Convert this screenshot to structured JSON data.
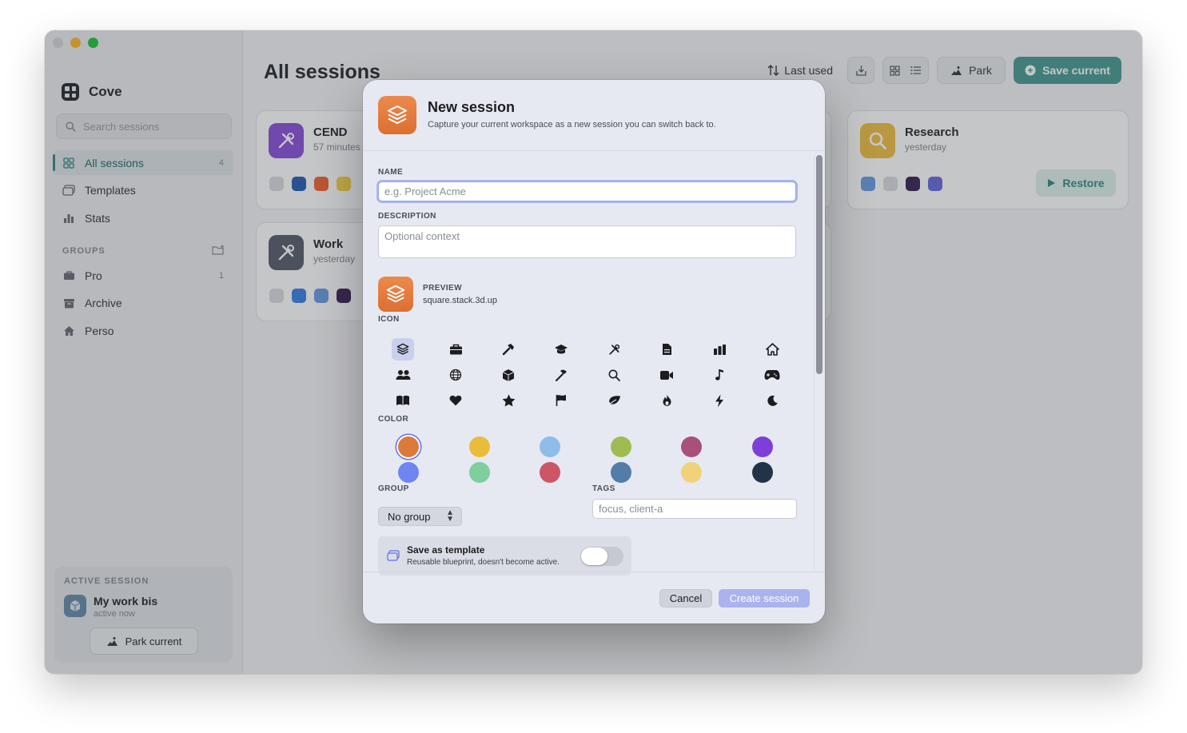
{
  "app": {
    "name": "Cove"
  },
  "sidebar": {
    "search_placeholder": "Search sessions",
    "nav": [
      {
        "label": "All sessions",
        "count": "4"
      },
      {
        "label": "Templates"
      },
      {
        "label": "Stats"
      }
    ],
    "groups_label": "GROUPS",
    "groups": [
      {
        "label": "Pro",
        "count": "1"
      },
      {
        "label": "Archive"
      },
      {
        "label": "Perso"
      }
    ],
    "active_session": {
      "label": "ACTIVE SESSION",
      "name": "My work bis",
      "status": "active now",
      "park_label": "Park current"
    }
  },
  "main": {
    "title": "All sessions",
    "sort_label": "Last used",
    "park_label": "Park",
    "save_label": "Save current",
    "cards": [
      {
        "title": "CEND",
        "subtitle": "57 minutes ago",
        "color": "#8e55d9"
      },
      {
        "title": "Work",
        "subtitle": "yesterday",
        "color": "#5b6370"
      },
      {
        "title": "Research",
        "subtitle": "yesterday",
        "color": "#f0c24b",
        "restore_label": "Restore"
      }
    ]
  },
  "modal": {
    "title": "New session",
    "subtitle": "Capture your current workspace as a new session you can switch back to.",
    "name_label": "NAME",
    "name_placeholder": "e.g. Project Acme",
    "description_label": "DESCRIPTION",
    "description_placeholder": "Optional context",
    "preview_label": "PREVIEW",
    "preview_value": "square.stack.3d.up",
    "icon_label": "ICON",
    "icons": [
      "square-stack-icon",
      "briefcase-icon",
      "hammer-icon",
      "graduation-cap-icon",
      "tools-icon",
      "document-icon",
      "chart-bar-icon",
      "house-icon",
      "people-icon",
      "globe-icon",
      "cube-icon",
      "hammer-icon",
      "magnifier-icon",
      "video-icon",
      "music-note-icon",
      "gamecontroller-icon",
      "book-icon",
      "heart-icon",
      "star-icon",
      "flag-icon",
      "leaf-icon",
      "flame-icon",
      "bolt-icon",
      "moon-icon"
    ],
    "selected_icon": 0,
    "color_label": "COLOR",
    "colors": [
      "#dc7a3c",
      "#e8bd3a",
      "#8fbde9",
      "#9fbc52",
      "#a8507a",
      "#7e3fd9",
      "#6d86f0",
      "#7ecf9b",
      "#cd5566",
      "#547ca8",
      "#f0d27a",
      "#233347"
    ],
    "selected_color": 0,
    "group_label": "GROUP",
    "group_value": "No group",
    "tags_label": "TAGS",
    "tags_placeholder": "focus, client-a",
    "template_title": "Save as template",
    "template_subtitle": "Reusable blueprint, doesn't become active.",
    "cancel_label": "Cancel",
    "create_label": "Create session"
  }
}
